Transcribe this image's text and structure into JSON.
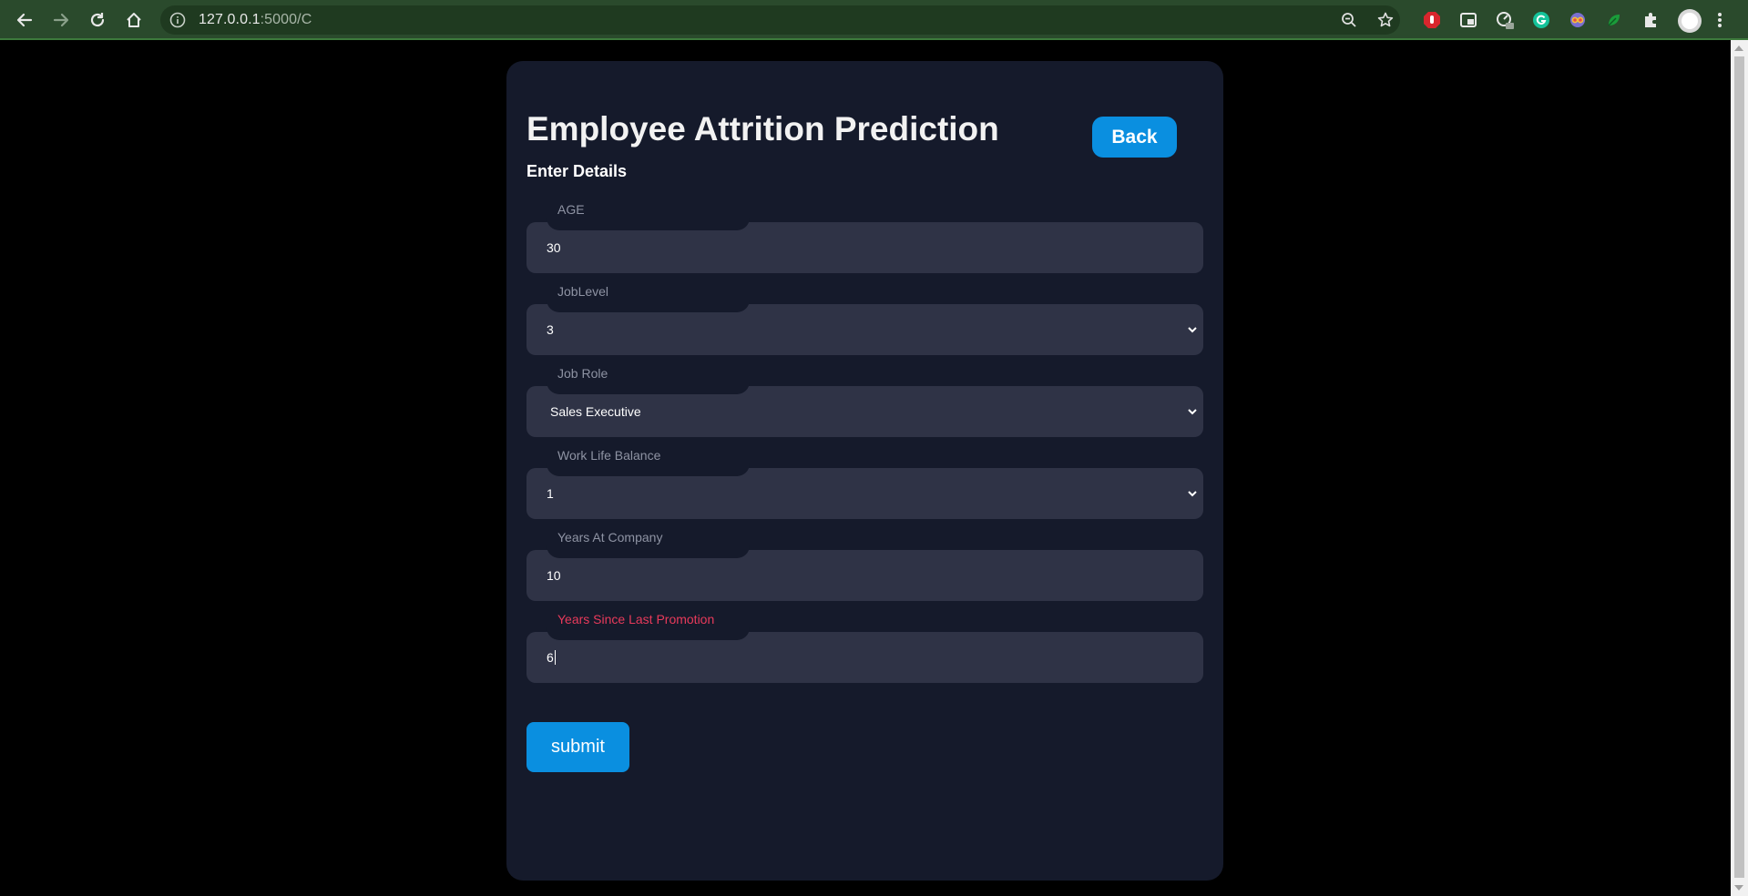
{
  "browser": {
    "url_host": "127.0.0.1",
    "url_path": ":5000/C"
  },
  "page": {
    "title": "Employee Attrition Prediction",
    "subtitle": "Enter Details",
    "back_label": "Back",
    "submit_label": "submit"
  },
  "form": {
    "age": {
      "label": "AGE",
      "value": "30"
    },
    "job_level": {
      "label": "JobLevel",
      "value": "3"
    },
    "job_role": {
      "label": "Job Role",
      "value": "Sales Executive"
    },
    "work_life_balance": {
      "label": "Work Life Balance",
      "value": "1"
    },
    "years_at_company": {
      "label": "Years At Company",
      "value": "10"
    },
    "years_since_last_promotion": {
      "label": "Years Since Last Promotion",
      "value": "6"
    }
  },
  "colors": {
    "background": "#000000",
    "card": "#151a2b",
    "field": "#2f3346",
    "accent_button": "#0a8fe0",
    "active_label": "#e83a5b",
    "browser_bar": "#2a4a2c"
  }
}
